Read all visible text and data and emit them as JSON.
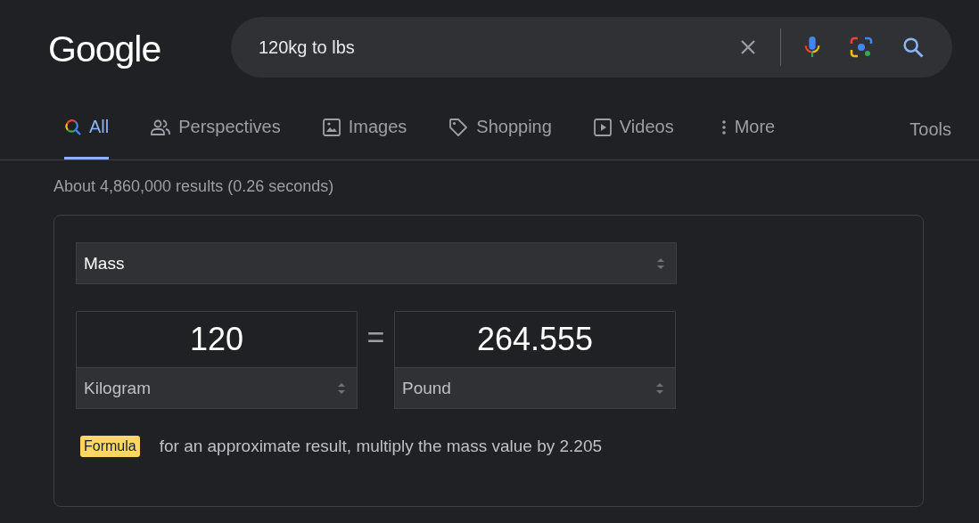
{
  "logo": "Google",
  "search": {
    "value": "120kg to lbs"
  },
  "tabs": [
    {
      "label": "All",
      "selected": true,
      "kind": "all"
    },
    {
      "label": "Perspectives",
      "selected": false,
      "kind": "people"
    },
    {
      "label": "Images",
      "selected": false,
      "kind": "image"
    },
    {
      "label": "Shopping",
      "selected": false,
      "kind": "tag"
    },
    {
      "label": "Videos",
      "selected": false,
      "kind": "play"
    },
    {
      "label": "More",
      "selected": false,
      "kind": "dots"
    }
  ],
  "tools": "Tools",
  "result_stats": "About 4,860,000 results (0.26 seconds)",
  "converter": {
    "quantity": "Mass",
    "from": {
      "value": "120",
      "unit": "Kilogram"
    },
    "equals": "=",
    "to": {
      "value": "264.555",
      "unit": "Pound"
    },
    "formula_label": "Formula",
    "formula_text": "for an approximate result, multiply the mass value by 2.205"
  }
}
